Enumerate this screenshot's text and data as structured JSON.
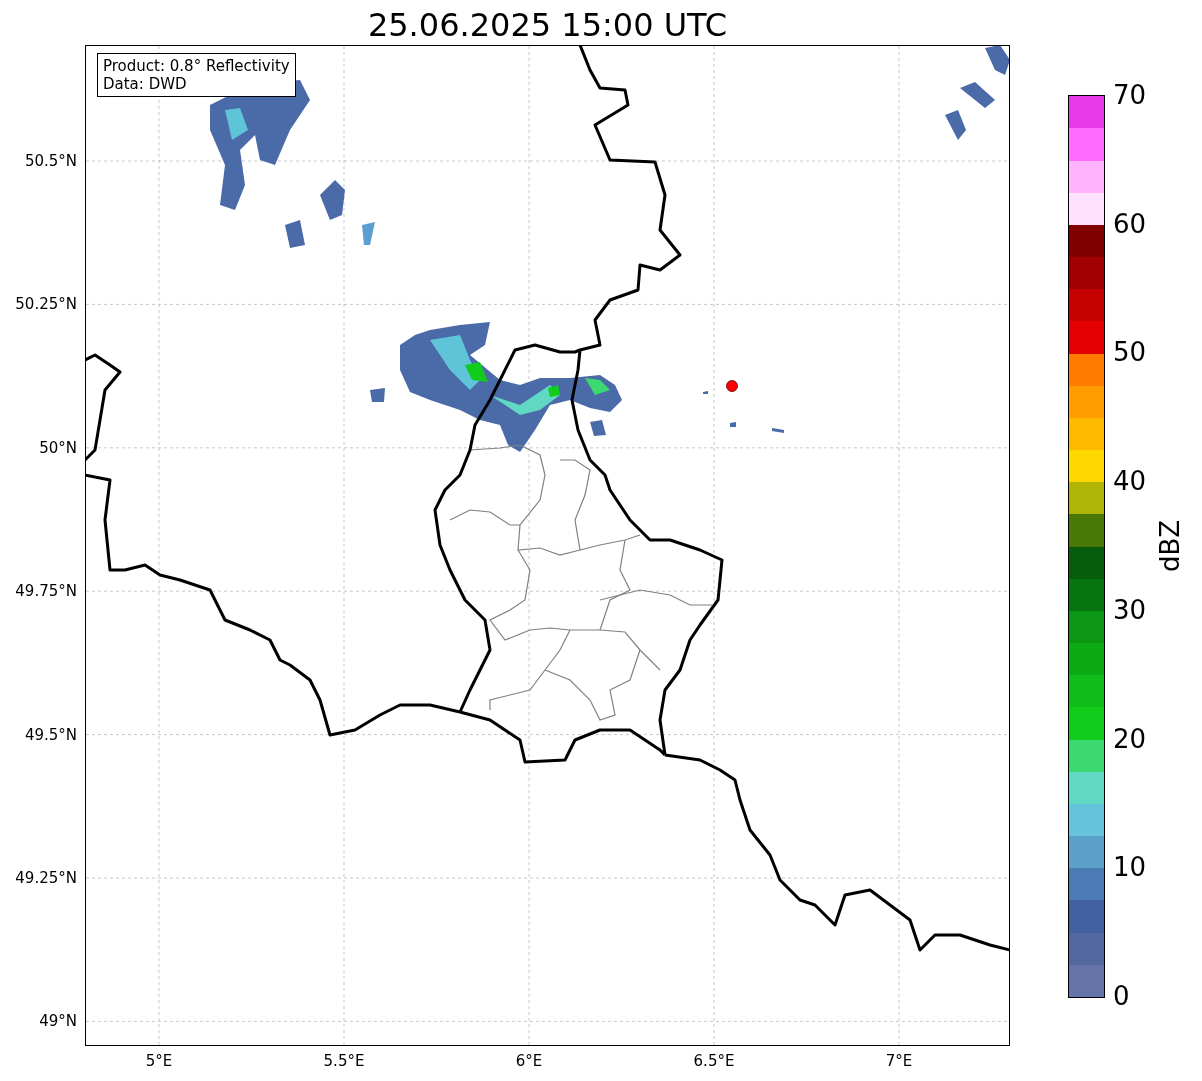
{
  "title": "25.06.2025 15:00 UTC",
  "legend": [
    "Product: 0.8° Reflectivity",
    "Data: DWD"
  ],
  "y_ticks": [
    "50.5°N",
    "50.25°N",
    "50°N",
    "49.75°N",
    "49.5°N",
    "49.25°N",
    "49°N"
  ],
  "x_ticks": [
    "5°E",
    "5.5°E",
    "6°E",
    "6.5°E",
    "7°E"
  ],
  "colorbar": {
    "label": "dBZ",
    "ticks": [
      "70",
      "60",
      "50",
      "40",
      "30",
      "20",
      "10",
      "0"
    ],
    "segments": [
      {
        "color": "#6574a8"
      },
      {
        "color": "#5468a0"
      },
      {
        "color": "#4360a0"
      },
      {
        "color": "#4a7bb4"
      },
      {
        "color": "#5aa0c8"
      },
      {
        "color": "#66c3dc"
      },
      {
        "color": "#60d8c4"
      },
      {
        "color": "#3cd870"
      },
      {
        "color": "#12cc1c"
      },
      {
        "color": "#10bc18"
      },
      {
        "color": "#0eaa14"
      },
      {
        "color": "#0c9614"
      },
      {
        "color": "#087410"
      },
      {
        "color": "#065e0c"
      },
      {
        "color": "#487808"
      },
      {
        "color": "#b0b404"
      },
      {
        "color": "#ffd800"
      },
      {
        "color": "#ffba00"
      },
      {
        "color": "#ff9c00"
      },
      {
        "color": "#ff7c00"
      },
      {
        "color": "#e40000"
      },
      {
        "color": "#c40000"
      },
      {
        "color": "#a00000"
      },
      {
        "color": "#800000"
      },
      {
        "color": "#ffe0ff"
      },
      {
        "color": "#ffb4ff"
      },
      {
        "color": "#ff6cff"
      },
      {
        "color": "#e838e8"
      }
    ]
  }
}
